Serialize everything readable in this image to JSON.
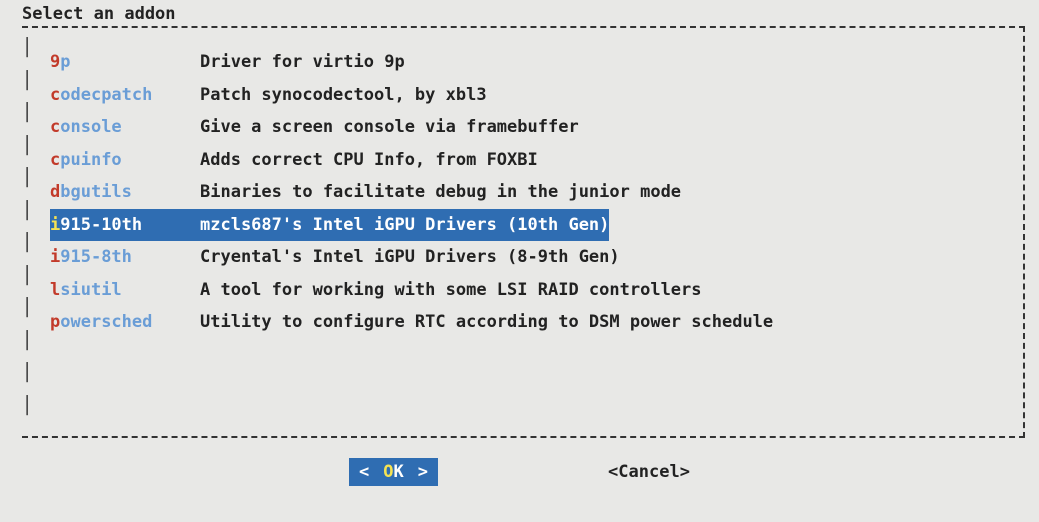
{
  "title": "Select an addon",
  "items": [
    {
      "hotkey": "9",
      "rest": "p",
      "desc": "Driver for virtio 9p",
      "selected": false
    },
    {
      "hotkey": "c",
      "rest": "odecpatch",
      "desc": "Patch synocodectool, by xbl3",
      "selected": false
    },
    {
      "hotkey": "c",
      "rest": "onsole",
      "desc": "Give a screen console via framebuffer",
      "selected": false
    },
    {
      "hotkey": "c",
      "rest": "puinfo",
      "desc": "Adds correct CPU Info, from FOXBI",
      "selected": false
    },
    {
      "hotkey": "d",
      "rest": "bgutils",
      "desc": "Binaries to facilitate debug in the junior mode",
      "selected": false
    },
    {
      "hotkey": "i",
      "rest": "915-10th",
      "desc": "mzcls687's Intel iGPU Drivers (10th Gen)",
      "selected": true
    },
    {
      "hotkey": "i",
      "rest": "915-8th",
      "desc": "Cryental's Intel iGPU Drivers (8-9th Gen)",
      "selected": false
    },
    {
      "hotkey": "l",
      "rest": "siutil",
      "desc": "A tool for working with some LSI RAID controllers",
      "selected": false
    },
    {
      "hotkey": "p",
      "rest": "owersched",
      "desc": "Utility to configure RTC according to DSM power schedule",
      "selected": false
    }
  ],
  "buttons": {
    "ok_hot": "O",
    "ok_rest": "K",
    "cancel": "<Cancel>"
  }
}
